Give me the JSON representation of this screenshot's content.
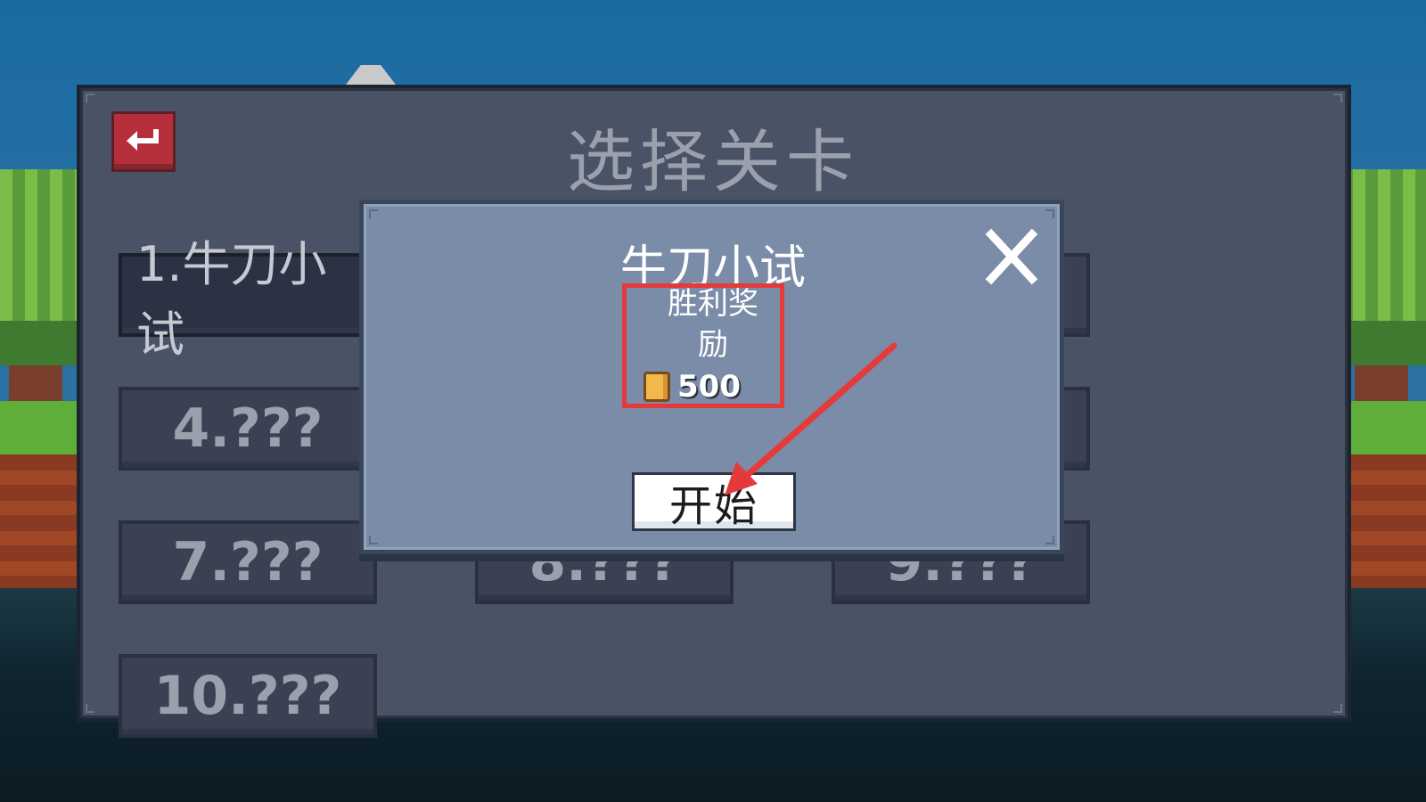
{
  "panel": {
    "title": "选择关卡"
  },
  "levels": [
    {
      "label": "1.牛刀小试"
    },
    {
      "label": "4.???"
    },
    {
      "label": "7.???"
    },
    {
      "label": "8.???"
    },
    {
      "label": "9.???"
    },
    {
      "label": "10.???"
    }
  ],
  "dialog": {
    "title": "牛刀小试",
    "reward_label": "胜利奖励",
    "reward_amount": "500",
    "start_label": "开始",
    "close_symbol": "✕"
  },
  "colors": {
    "back_button": "#b52f3a",
    "highlight": "#e53a3a",
    "dialog_bg": "#7a8ca7",
    "panel_bg": "#4a5366"
  },
  "icons": [
    "back-icon",
    "close-icon",
    "coin-icon"
  ]
}
